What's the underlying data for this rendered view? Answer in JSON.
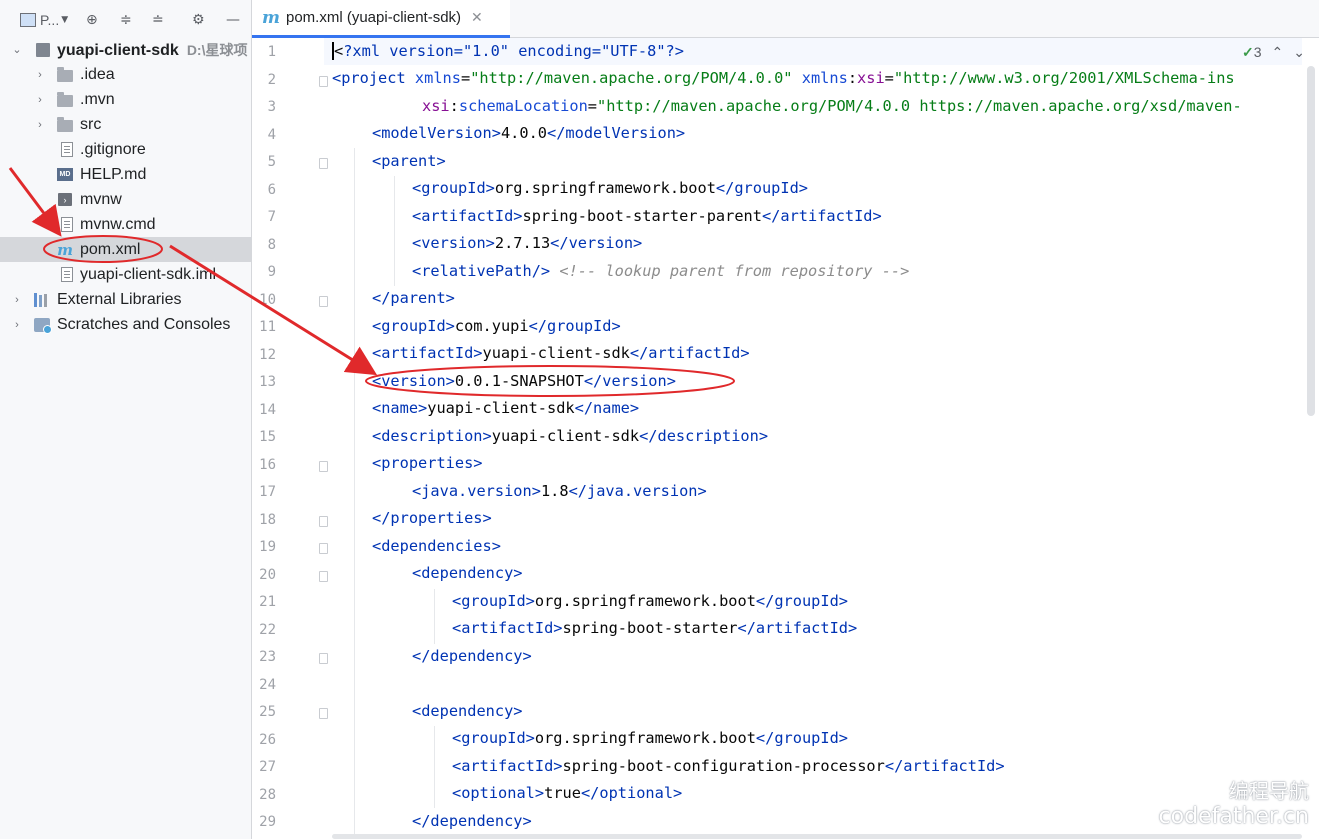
{
  "project_panel": {
    "title": "P...",
    "toolbar_icons": [
      "locate-icon",
      "expand-all-icon",
      "collapse-all-icon",
      "gear-icon",
      "minimize-icon"
    ],
    "root": {
      "name": "yuapi-client-sdk",
      "path": "D:\\星球项"
    },
    "items": [
      {
        "label": ".idea"
      },
      {
        "label": ".mvn"
      },
      {
        "label": "src"
      },
      {
        "label": ".gitignore"
      },
      {
        "label": "HELP.md"
      },
      {
        "label": "mvnw"
      },
      {
        "label": "mvnw.cmd"
      },
      {
        "label": "pom.xml"
      },
      {
        "label": "yuapi-client-sdk.iml"
      },
      {
        "label": "External Libraries"
      },
      {
        "label": "Scratches and Consoles"
      }
    ]
  },
  "editor": {
    "tab_title": "pom.xml (yuapi-client-sdk)",
    "inspection_count": "3",
    "line_numbers": [
      "1",
      "2",
      "3",
      "4",
      "5",
      "6",
      "7",
      "8",
      "9",
      "10",
      "11",
      "12",
      "13",
      "14",
      "15",
      "16",
      "17",
      "18",
      "19",
      "20",
      "21",
      "22",
      "23",
      "24",
      "25",
      "26",
      "27",
      "28",
      "29"
    ],
    "code": {
      "l1_decl": "?xml version=\"1.0\" encoding=\"UTF-8\"?>",
      "l2_tag": "project",
      "l2_xmlns": "\"http://maven.apache.org/POM/4.0.0\"",
      "l2_xsi_val": "\"http://www.w3.org/2001/XMLSchema-ins",
      "l3_val": "\"http://maven.apache.org/POM/4.0.0 https://maven.apache.org/xsd/maven-",
      "modelVersion": "4.0.0",
      "parent_groupId": "org.springframework.boot",
      "parent_artifactId": "spring-boot-starter-parent",
      "parent_version": "2.7.13",
      "relativePath_comment": "<!-- lookup parent from repository -->",
      "groupId": "com.yupi",
      "artifactId": "yuapi-client-sdk",
      "version": "0.0.1-SNAPSHOT",
      "name": "yuapi-client-sdk",
      "description": "yuapi-client-sdk",
      "java_version": "1.8",
      "dep1_groupId": "org.springframework.boot",
      "dep1_artifactId": "spring-boot-starter",
      "dep2_groupId": "org.springframework.boot",
      "dep2_artifactId": "spring-boot-configuration-processor",
      "dep2_optional": "true"
    }
  },
  "watermark": {
    "line1": "编程导航",
    "line2": "codefather.cn"
  },
  "colors": {
    "annotation": "#e0292b",
    "selection": "#d5d7db",
    "tab_accent": "#3574f0"
  }
}
